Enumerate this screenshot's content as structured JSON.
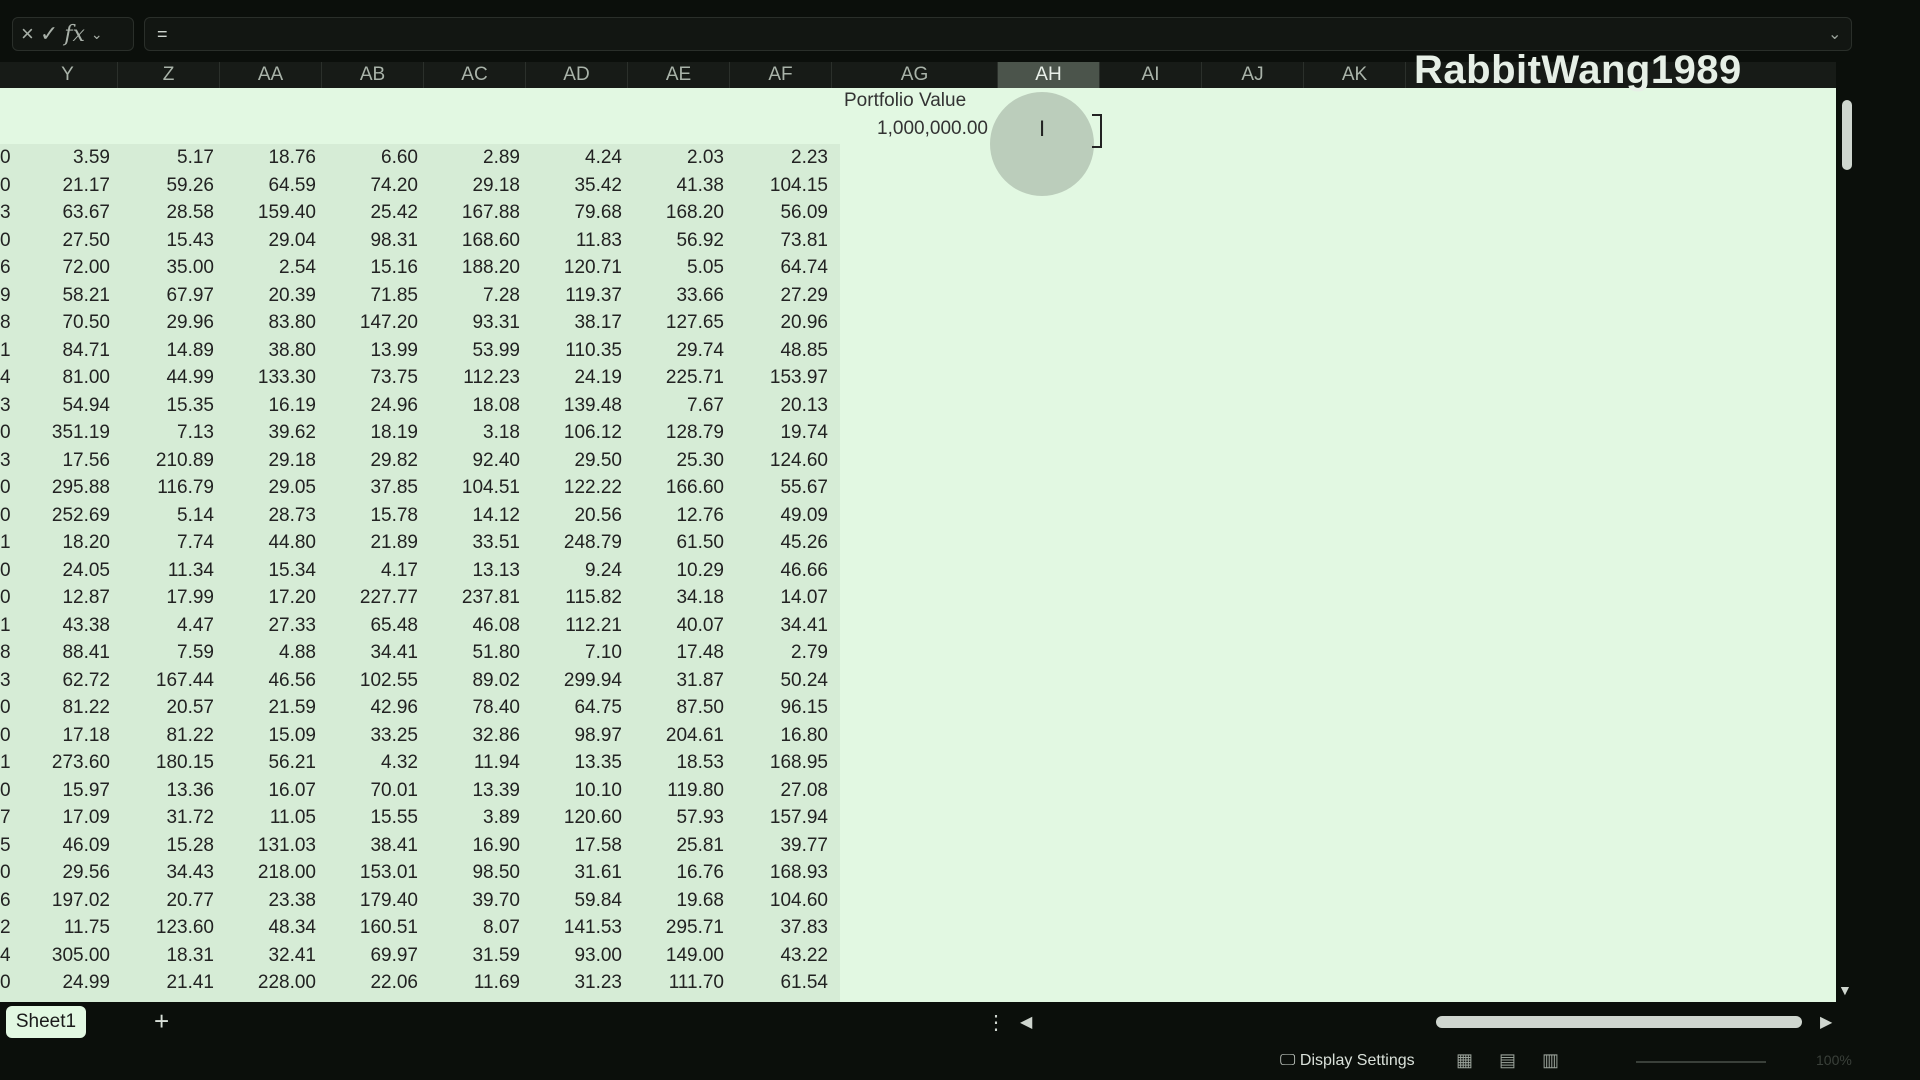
{
  "formula_bar": {
    "cancel_icon": "×",
    "enter_icon": "✓",
    "fx_label": "fx",
    "value": "="
  },
  "columns": [
    {
      "label": "Y",
      "selected": false
    },
    {
      "label": "Z",
      "selected": false
    },
    {
      "label": "AA",
      "selected": false
    },
    {
      "label": "AB",
      "selected": false
    },
    {
      "label": "AC",
      "selected": false
    },
    {
      "label": "AD",
      "selected": false
    },
    {
      "label": "AE",
      "selected": false
    },
    {
      "label": "AF",
      "selected": false
    },
    {
      "label": "AG",
      "selected": false
    },
    {
      "label": "AH",
      "selected": true
    },
    {
      "label": "AI",
      "selected": false
    },
    {
      "label": "AJ",
      "selected": false
    },
    {
      "label": "AK",
      "selected": false
    }
  ],
  "portfolio": {
    "label": "Portfolio Value",
    "value": "1,000,000.00"
  },
  "row_prefixes": [
    "0",
    "0",
    "3",
    "0",
    "6",
    "9",
    "8",
    "1",
    "4",
    "3",
    "0",
    "3",
    "0",
    "0",
    "1",
    "0",
    "0",
    "1",
    "8",
    "3",
    "0",
    "0",
    "1",
    "0",
    "7",
    "5",
    "0",
    "6",
    "2",
    "4",
    "0"
  ],
  "rows": [
    [
      "3.59",
      "5.17",
      "18.76",
      "6.60",
      "2.89",
      "4.24",
      "2.03",
      "2.23"
    ],
    [
      "21.17",
      "59.26",
      "64.59",
      "74.20",
      "29.18",
      "35.42",
      "41.38",
      "104.15"
    ],
    [
      "63.67",
      "28.58",
      "159.40",
      "25.42",
      "167.88",
      "79.68",
      "168.20",
      "56.09"
    ],
    [
      "27.50",
      "15.43",
      "29.04",
      "98.31",
      "168.60",
      "11.83",
      "56.92",
      "73.81"
    ],
    [
      "72.00",
      "35.00",
      "2.54",
      "15.16",
      "188.20",
      "120.71",
      "5.05",
      "64.74"
    ],
    [
      "58.21",
      "67.97",
      "20.39",
      "71.85",
      "7.28",
      "119.37",
      "33.66",
      "27.29"
    ],
    [
      "70.50",
      "29.96",
      "83.80",
      "147.20",
      "93.31",
      "38.17",
      "127.65",
      "20.96"
    ],
    [
      "84.71",
      "14.89",
      "38.80",
      "13.99",
      "53.99",
      "110.35",
      "29.74",
      "48.85"
    ],
    [
      "81.00",
      "44.99",
      "133.30",
      "73.75",
      "112.23",
      "24.19",
      "225.71",
      "153.97"
    ],
    [
      "54.94",
      "15.35",
      "16.19",
      "24.96",
      "18.08",
      "139.48",
      "7.67",
      "20.13"
    ],
    [
      "351.19",
      "7.13",
      "39.62",
      "18.19",
      "3.18",
      "106.12",
      "128.79",
      "19.74"
    ],
    [
      "17.56",
      "210.89",
      "29.18",
      "29.82",
      "92.40",
      "29.50",
      "25.30",
      "124.60"
    ],
    [
      "295.88",
      "116.79",
      "29.05",
      "37.85",
      "104.51",
      "122.22",
      "166.60",
      "55.67"
    ],
    [
      "252.69",
      "5.14",
      "28.73",
      "15.78",
      "14.12",
      "20.56",
      "12.76",
      "49.09"
    ],
    [
      "18.20",
      "7.74",
      "44.80",
      "21.89",
      "33.51",
      "248.79",
      "61.50",
      "45.26"
    ],
    [
      "24.05",
      "11.34",
      "15.34",
      "4.17",
      "13.13",
      "9.24",
      "10.29",
      "46.66"
    ],
    [
      "12.87",
      "17.99",
      "17.20",
      "227.77",
      "237.81",
      "115.82",
      "34.18",
      "14.07"
    ],
    [
      "43.38",
      "4.47",
      "27.33",
      "65.48",
      "46.08",
      "112.21",
      "40.07",
      "34.41"
    ],
    [
      "88.41",
      "7.59",
      "4.88",
      "34.41",
      "51.80",
      "7.10",
      "17.48",
      "2.79"
    ],
    [
      "62.72",
      "167.44",
      "46.56",
      "102.55",
      "89.02",
      "299.94",
      "31.87",
      "50.24"
    ],
    [
      "81.22",
      "20.57",
      "21.59",
      "42.96",
      "78.40",
      "64.75",
      "87.50",
      "96.15"
    ],
    [
      "17.18",
      "81.22",
      "15.09",
      "33.25",
      "32.86",
      "98.97",
      "204.61",
      "16.80"
    ],
    [
      "273.60",
      "180.15",
      "56.21",
      "4.32",
      "11.94",
      "13.35",
      "18.53",
      "168.95"
    ],
    [
      "15.97",
      "13.36",
      "16.07",
      "70.01",
      "13.39",
      "10.10",
      "119.80",
      "27.08"
    ],
    [
      "17.09",
      "31.72",
      "11.05",
      "15.55",
      "3.89",
      "120.60",
      "57.93",
      "157.94"
    ],
    [
      "46.09",
      "15.28",
      "131.03",
      "38.41",
      "16.90",
      "17.58",
      "25.81",
      "39.77"
    ],
    [
      "29.56",
      "34.43",
      "218.00",
      "153.01",
      "98.50",
      "31.61",
      "16.76",
      "168.93"
    ],
    [
      "197.02",
      "20.77",
      "23.38",
      "179.40",
      "39.70",
      "59.84",
      "19.68",
      "104.60"
    ],
    [
      "11.75",
      "123.60",
      "48.34",
      "160.51",
      "8.07",
      "141.53",
      "295.71",
      "37.83"
    ],
    [
      "305.00",
      "18.31",
      "32.41",
      "69.97",
      "31.59",
      "93.00",
      "149.00",
      "43.22"
    ],
    [
      "24.99",
      "21.41",
      "228.00",
      "22.06",
      "11.69",
      "31.23",
      "111.70",
      "61.54"
    ]
  ],
  "watermark": {
    "text": "RabbitWang1989",
    "logo": "bilibili"
  },
  "sheet_bar": {
    "tab": "Sheet1",
    "add_icon": "+",
    "more_icon": "⋮",
    "left_arrow_icon": "◀",
    "right_arrow_icon": "▶"
  },
  "status_bar": {
    "display_settings": "Display Settings",
    "zoom": "100%"
  }
}
